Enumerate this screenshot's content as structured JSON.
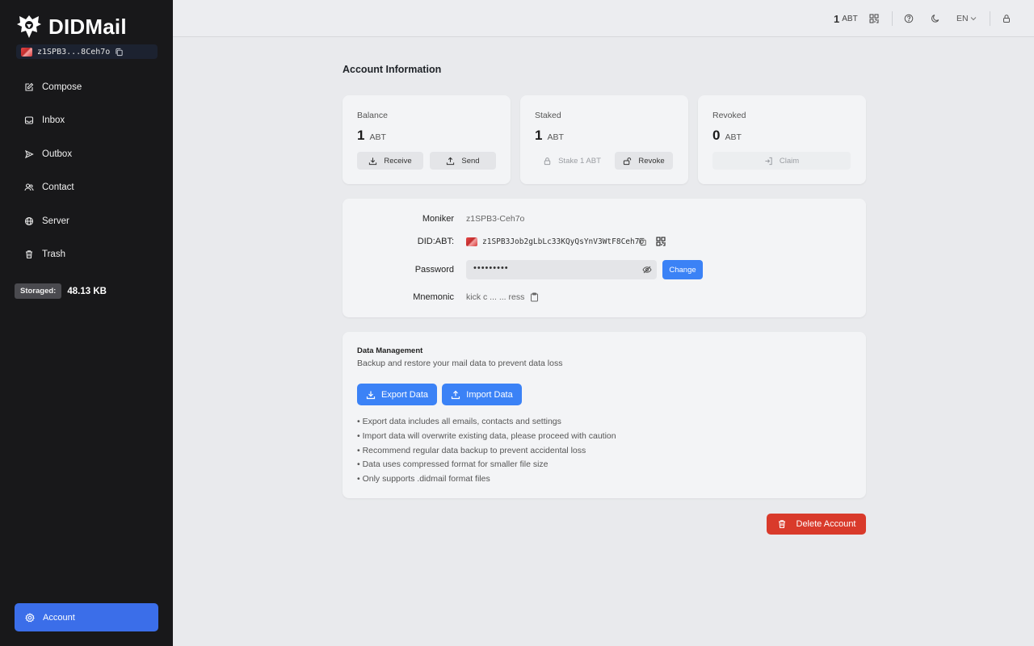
{
  "sidebar": {
    "app_name": "DIDMail",
    "did_short": "z1SPB3...8Ceh7o",
    "nav": [
      {
        "label": "Compose",
        "icon": "edit-icon"
      },
      {
        "label": "Inbox",
        "icon": "inbox-icon"
      },
      {
        "label": "Outbox",
        "icon": "send-icon"
      },
      {
        "label": "Contact",
        "icon": "users-icon"
      },
      {
        "label": "Server",
        "icon": "globe-icon"
      },
      {
        "label": "Trash",
        "icon": "trash-icon"
      }
    ],
    "storage_label": "Storaged:",
    "storage_value": "48.13 KB",
    "account_label": "Account"
  },
  "topbar": {
    "balance_value": "1",
    "balance_unit": "ABT",
    "language": "EN"
  },
  "main": {
    "title": "Account Information",
    "balance": {
      "label": "Balance",
      "value": "1",
      "unit": "ABT",
      "receive": "Receive",
      "send": "Send"
    },
    "staked": {
      "label": "Staked",
      "value": "1",
      "unit": "ABT",
      "stake": "Stake 1 ABT",
      "revoke": "Revoke"
    },
    "revoked": {
      "label": "Revoked",
      "value": "0",
      "unit": "ABT",
      "claim": "Claim"
    },
    "details": {
      "moniker_label": "Moniker",
      "moniker_value": "z1SPB3-Ceh7o",
      "did_label": "DID:ABT:",
      "did_value": "z1SPB3Job2gLbLc33KQyQsYnV3WtF8Ceh7o",
      "password_label": "Password",
      "password_value": "•••••••••",
      "change_label": "Change",
      "mnemonic_label": "Mnemonic",
      "mnemonic_value": "kick c ... ... ress"
    },
    "data_management": {
      "title": "Data Management",
      "subtitle": "Backup and restore your mail data to prevent data loss",
      "export_label": "Export Data",
      "import_label": "Import Data",
      "tips": [
        "Export data includes all emails, contacts and settings",
        "Import data will overwrite existing data, please proceed with caution",
        "Recommend regular data backup to prevent accidental loss",
        "Data uses compressed format for smaller file size",
        "Only supports .didmail format files"
      ]
    },
    "delete_label": "Delete Account"
  },
  "colors": {
    "sidebar_bg": "#18181a",
    "accent_blue": "#3b82f6",
    "active_nav": "#3b6ee9",
    "danger": "#d93a2b"
  }
}
